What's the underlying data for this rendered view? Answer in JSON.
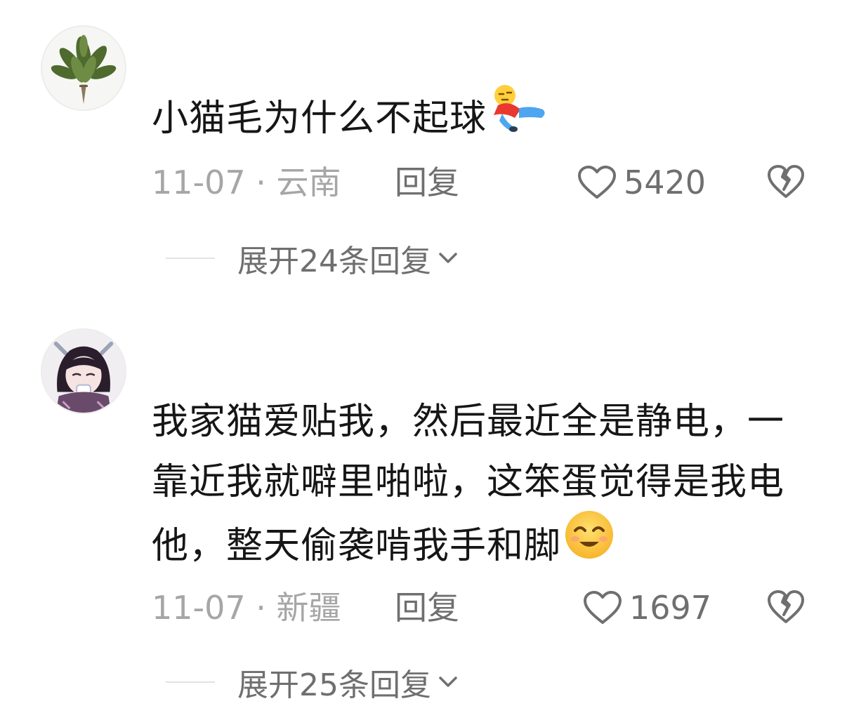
{
  "comments": [
    {
      "avatar": "leaf-bouquet-avatar",
      "text": "小猫毛为什么不起球",
      "emoji": "lying-person-emoji",
      "date": "11-07",
      "separator": "·",
      "location": "云南",
      "reply_label": "回复",
      "like_count": "5420",
      "expand_label": "展开24条回复"
    },
    {
      "avatar": "anime-girl-avatar",
      "text": "我家猫爱贴我，然后最近全是静电，一靠近我就噼里啪啦，这笨蛋觉得是我电他，整天偷袭啃我手和脚",
      "emoji": "smiling-face-emoji",
      "date": "11-07",
      "separator": "·",
      "location": "新疆",
      "reply_label": "回复",
      "like_count": "1697",
      "expand_label": "展开25条回复"
    }
  ],
  "colors": {
    "text": "#161616",
    "meta_gray": "#a6a6a6",
    "action_gray": "#6f6f6f",
    "divider": "#e2e2e2"
  }
}
